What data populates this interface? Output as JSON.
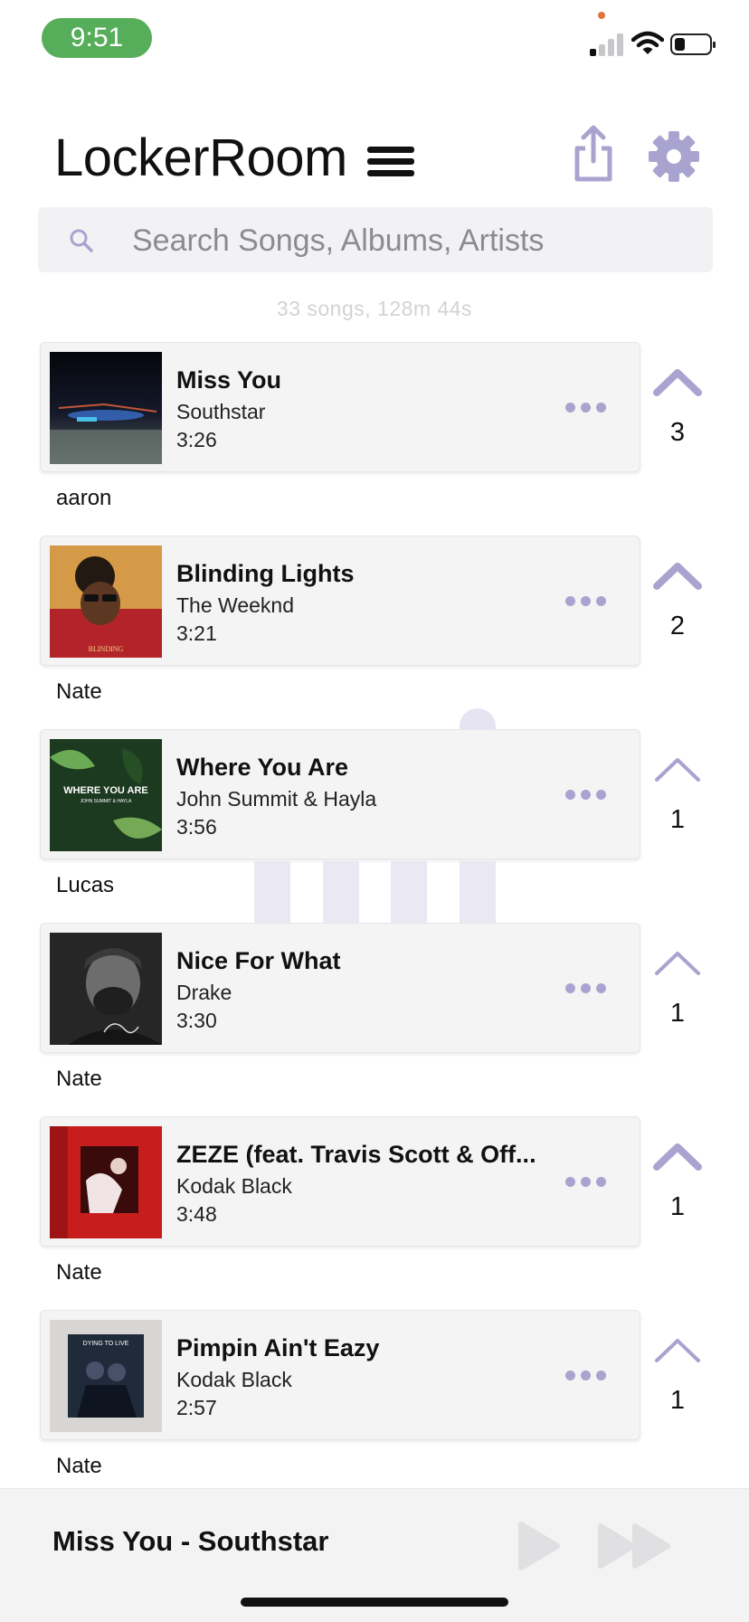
{
  "status_bar": {
    "time": "9:51",
    "notification_dot_color": "#e0733f",
    "pill_color": "#56ad5a",
    "battery_level": 0.25,
    "signal_bars": 1
  },
  "header": {
    "title": "LockerRoom",
    "icons": [
      "menu-icon",
      "share-icon",
      "gear-icon"
    ]
  },
  "search": {
    "placeholder": "Search Songs, Albums, Artists",
    "value": ""
  },
  "summary": "33 songs, 128m 44s",
  "accent_color": "#a9a3d0",
  "songs": [
    {
      "title": "Miss You",
      "artist": "Southstar",
      "duration": "3:26",
      "added_by": "aaron",
      "votes": "3",
      "upvoted": true,
      "art": "night-lake-art"
    },
    {
      "title": "Blinding Lights",
      "artist": "The Weeknd",
      "duration": "3:21",
      "added_by": "Nate",
      "votes": "2",
      "upvoted": true,
      "art": "weeknd-red-art"
    },
    {
      "title": "Where You Are",
      "artist": "John Summit & Hayla",
      "duration": "3:56",
      "added_by": "Lucas",
      "votes": "1",
      "upvoted": false,
      "art": "green-leaves-art"
    },
    {
      "title": "Nice For What",
      "artist": "Drake",
      "duration": "3:30",
      "added_by": "Nate",
      "votes": "1",
      "upvoted": false,
      "art": "drake-bw-art"
    },
    {
      "title": "ZEZE (feat. Travis Scott & Off...",
      "artist": "Kodak Black",
      "duration": "3:48",
      "added_by": "Nate",
      "votes": "1",
      "upvoted": true,
      "art": "red-room-art"
    },
    {
      "title": "Pimpin Ain't Eazy",
      "artist": "Kodak Black",
      "duration": "2:57",
      "added_by": "Nate",
      "votes": "1",
      "upvoted": false,
      "art": "grey-poster-art"
    }
  ],
  "now_playing": {
    "label": "Miss You - Southstar",
    "controls": [
      "play-icon",
      "skip-forward-icon"
    ]
  }
}
